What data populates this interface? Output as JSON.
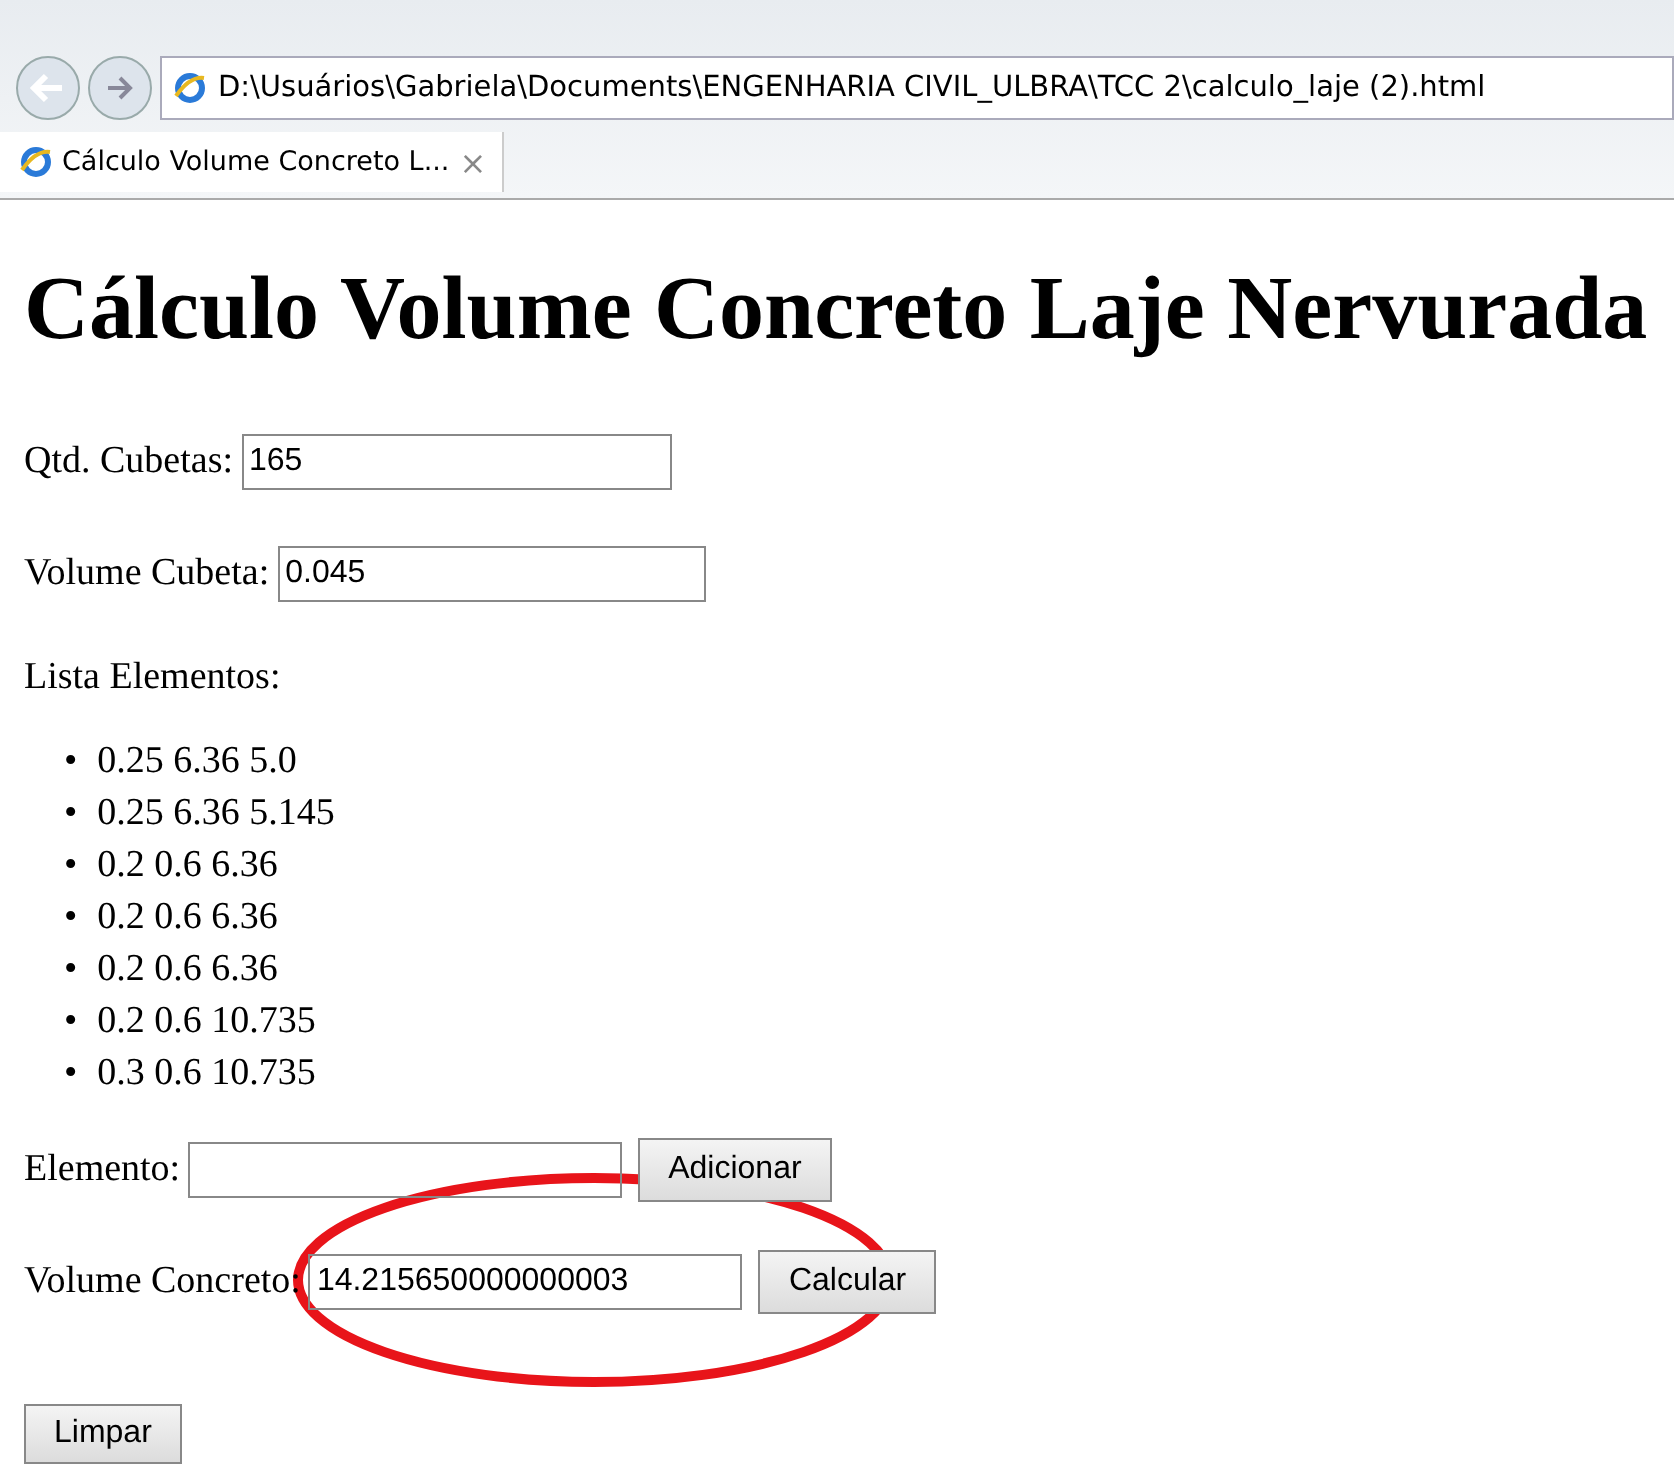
{
  "browser": {
    "address": "D:\\Usuários\\Gabriela\\Documents\\ENGENHARIA CIVIL_ULBRA\\TCC 2\\calculo_laje (2).html",
    "tab": {
      "title": "Cálculo Volume Concreto L...",
      "close": "×",
      "selected": true
    }
  },
  "page": {
    "heading": "Cálculo Volume Concreto Laje Nervurada",
    "fields": [
      {
        "label": "Qtd. Cubetas:",
        "value": "165"
      },
      {
        "label": "Volume Cubeta:",
        "value": "0.045"
      }
    ],
    "list_label": "Lista Elementos:",
    "elements": [
      {
        "marker": "•",
        "text": "0.25 6.36 5.0"
      },
      {
        "marker": "•",
        "text": "0.25 6.36 5.145"
      },
      {
        "marker": "•",
        "text": "0.2 0.6 6.36"
      },
      {
        "marker": "•",
        "text": "0.2 0.6 6.36"
      },
      {
        "marker": "•",
        "text": "0.2 0.6 6.36"
      },
      {
        "marker": "•",
        "text": "0.2 0.6 10.735"
      },
      {
        "marker": "•",
        "text": "0.3 0.6 10.735"
      }
    ],
    "element_field": {
      "label": "Elemento:",
      "button": "Adicionar"
    },
    "result_field": {
      "label": "Volume Concreto:",
      "value": "14.215650000000003",
      "button": "Calcular"
    },
    "clear_button": "Limpar"
  }
}
